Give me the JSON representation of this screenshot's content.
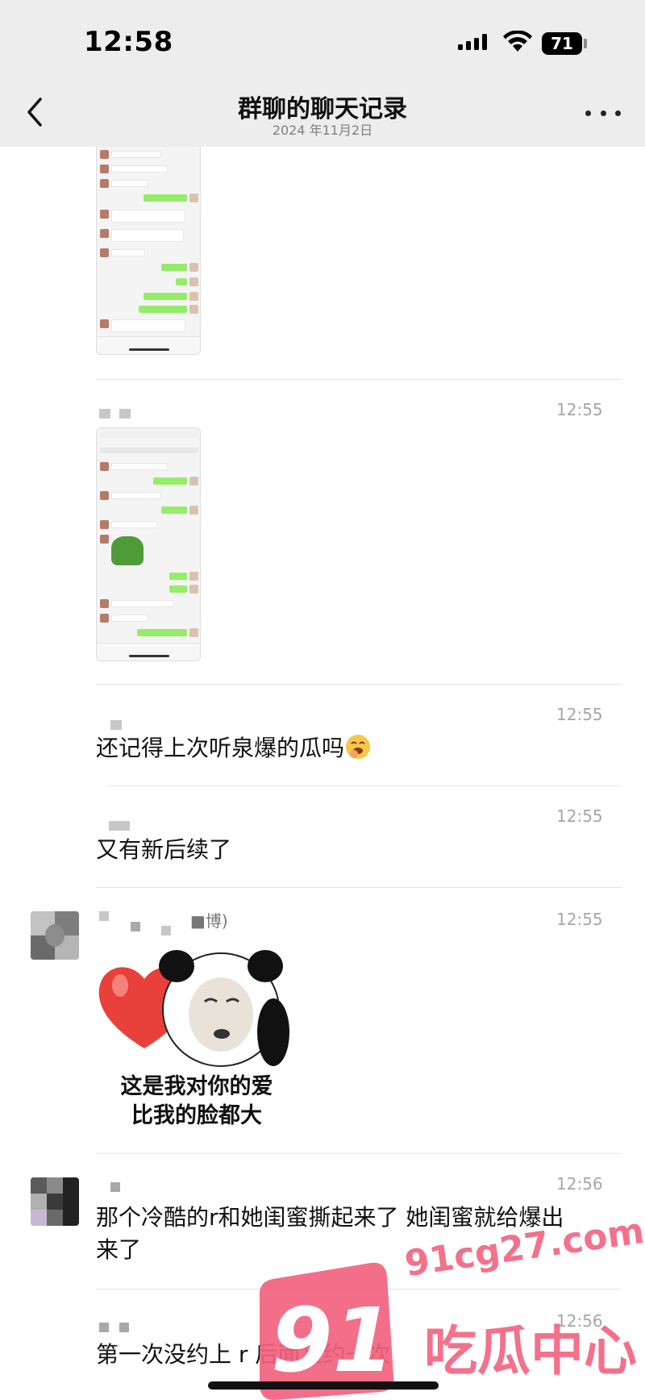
{
  "status": {
    "time": "12:58",
    "battery": "71"
  },
  "nav": {
    "title": "群聊的聊天记录",
    "subtitle": "2024 年11月2日"
  },
  "messages": [
    {
      "time": "12:55",
      "type": "image"
    },
    {
      "time": "12:55",
      "text": "还记得上次听泉爆的瓜吗"
    },
    {
      "time": "12:55",
      "text": "又有新后续了"
    },
    {
      "time": "12:55",
      "name_suffix": "■博)",
      "type": "sticker",
      "sticker_caption_1": "这是我对你的爱",
      "sticker_caption_2": "比我的脸都大"
    },
    {
      "time": "12:56",
      "text_line1": "那个冷酷的r和她闺蜜撕起来了 她闺蜜就给爆出",
      "text_line2": "来了"
    },
    {
      "time": "12:56",
      "text": "第一次没约上 r 后面又约一次"
    }
  ],
  "watermark": {
    "site": "91cg27.com",
    "brand": "吃瓜中心",
    "badge": "91"
  },
  "colors": {
    "topbar": "#ededed",
    "bubble_green": "#95ec69",
    "time_gray": "#a6a6a6",
    "watermark_pink": "#f2627f"
  }
}
